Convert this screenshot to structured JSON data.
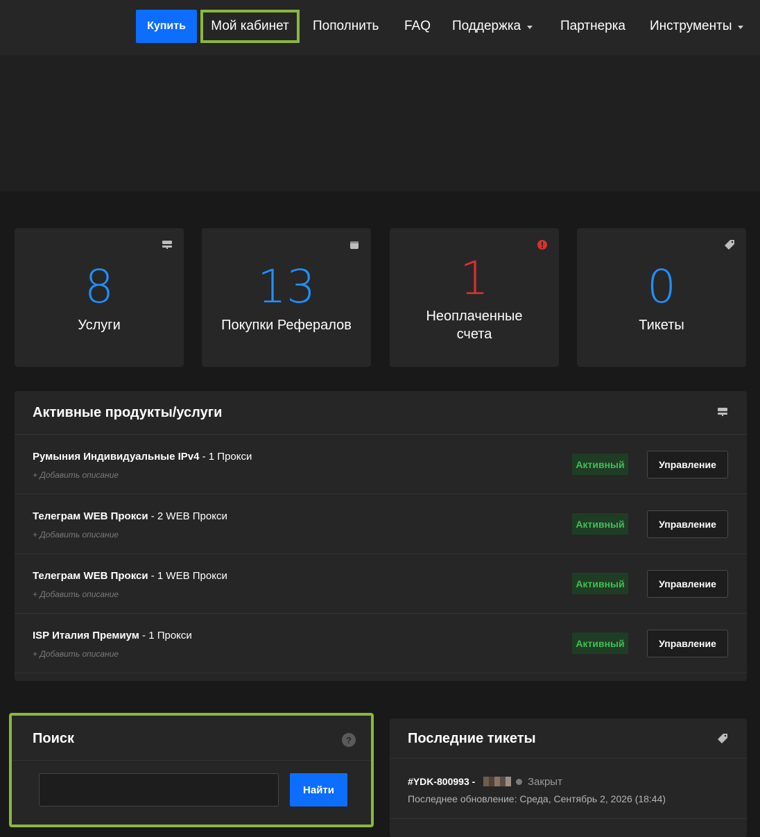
{
  "nav": {
    "buy": "Купить",
    "cabinet": "Мой кабинет",
    "topup": "Пополнить",
    "faq": "FAQ",
    "support": "Поддержка",
    "partner": "Партнерка",
    "tools": "Инструменты"
  },
  "stats": [
    {
      "value": "8",
      "label": "Услуги",
      "icon": "server-icon"
    },
    {
      "value": "13",
      "label": "Покупки Рефералов",
      "icon": "wallet-icon"
    },
    {
      "value": "1",
      "label": "Неоплаченные счета",
      "icon": "alert-circle-icon"
    },
    {
      "value": "0",
      "label": "Тикеты",
      "icon": "tag-icon"
    }
  ],
  "products": {
    "title": "Активные продукты/услуги",
    "items": [
      {
        "name": "Румыния Индивидуальные IPv4",
        "detail": " - 1 Прокси",
        "desc": "+ Добавить описание",
        "status": "Активный",
        "manage": "Управление"
      },
      {
        "name": "Телеграм WEB Прокси",
        "detail": " - 2 WEB Прокси",
        "desc": "+ Добавить описание",
        "status": "Активный",
        "manage": "Управление"
      },
      {
        "name": "Телеграм WEB Прокси",
        "detail": " - 1 WEB Прокси",
        "desc": "+ Добавить описание",
        "status": "Активный",
        "manage": "Управление"
      },
      {
        "name": "ISP Италия Премиум",
        "detail": " - 1 Прокси",
        "desc": "+ Добавить описание",
        "status": "Активный",
        "manage": "Управление"
      }
    ]
  },
  "search": {
    "title": "Поиск",
    "help": "?",
    "value": "",
    "button": "Найти"
  },
  "tickets": {
    "title": "Последние тикеты",
    "items": [
      {
        "id": "#YDK-800993 -",
        "status": "Закрыт",
        "updated": "Последнее обновление: Среда, Сентябрь 2, 2026 (18:44)"
      }
    ]
  },
  "colors": {
    "accent": "#0d6efd",
    "highlight": "#8ab83d",
    "number": "#1e90ff",
    "danger": "#d93030",
    "active": "#3fbf55"
  }
}
